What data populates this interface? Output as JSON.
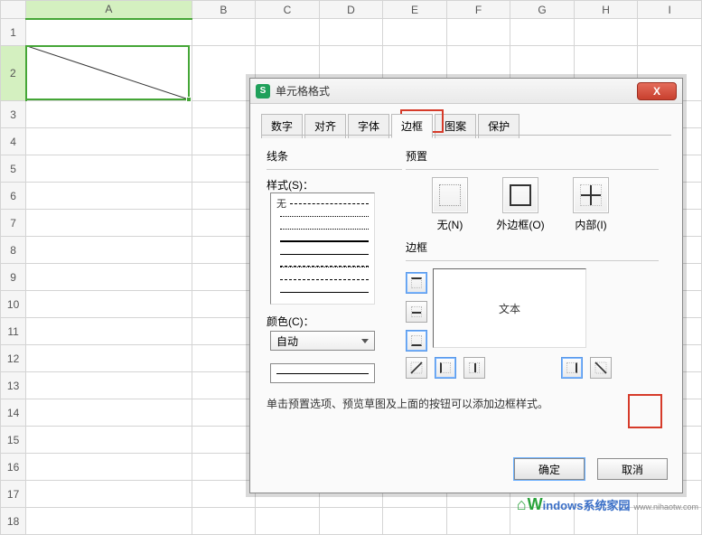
{
  "columns": [
    "A",
    "B",
    "C",
    "D",
    "E",
    "F",
    "G",
    "H",
    "I"
  ],
  "rows": [
    "1",
    "2",
    "3",
    "4",
    "5",
    "6",
    "7",
    "8",
    "9",
    "10",
    "11",
    "12",
    "13",
    "14",
    "15",
    "16",
    "17",
    "18"
  ],
  "dialog": {
    "title": "单元格格式",
    "close": "X",
    "tabs": {
      "number": "数字",
      "align": "对齐",
      "font": "字体",
      "border": "边框",
      "pattern": "图案",
      "protect": "保护"
    },
    "line_group": "线条",
    "style_label": "样式(S)：",
    "style_none": "无",
    "color_label": "颜色(C)：",
    "color_auto": "自动",
    "preset_group": "预置",
    "preset_none": "无(N)",
    "preset_outer": "外边框(O)",
    "preset_inner": "内部(I)",
    "border_group": "边框",
    "preview_text": "文本",
    "hint": "单击预置选项、预览草图及上面的按钮可以添加边框样式。",
    "ok": "确定",
    "cancel": "取消"
  },
  "watermark": {
    "brand_w": "W",
    "brand_rest": "indows",
    "suffix": "系统家园",
    "sub": "www.nihaotw.com"
  }
}
